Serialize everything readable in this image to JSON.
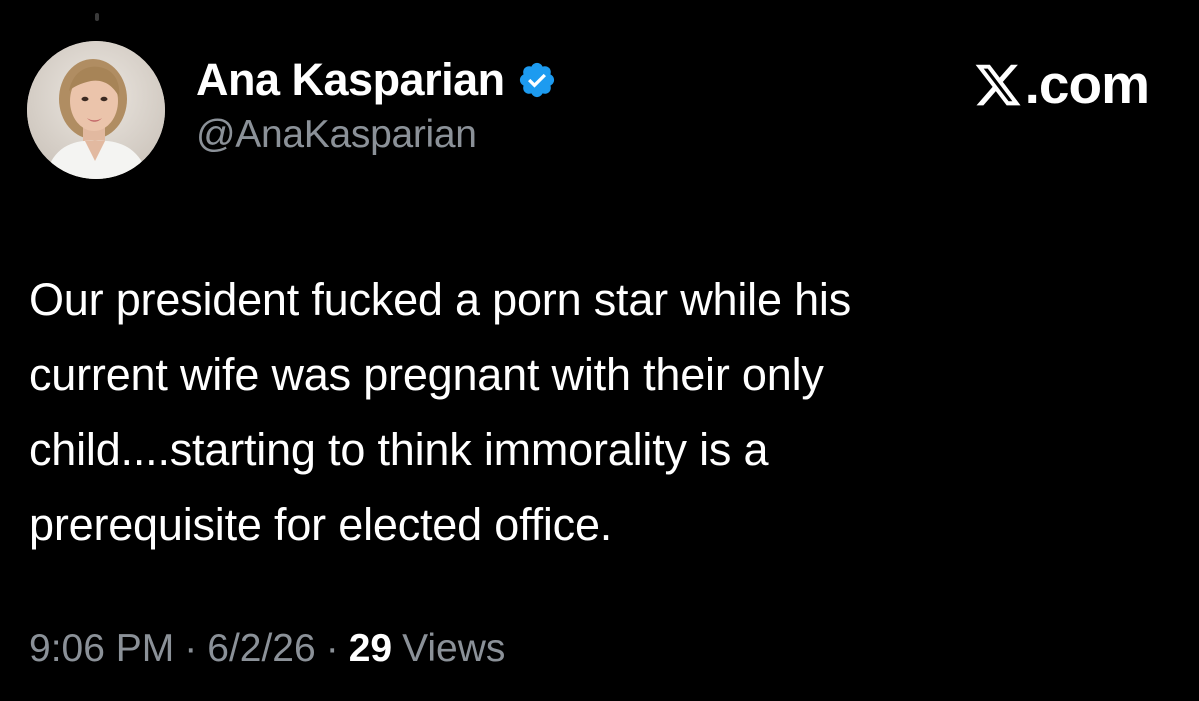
{
  "author": {
    "display_name": "Ana Kasparian",
    "handle": "@AnaKasparian",
    "verified": true,
    "badge_color": "#1d9bf0"
  },
  "brand": {
    "label": ".com",
    "logo_icon": "x-logo-icon"
  },
  "tweet": {
    "lines": [
      "Our president fucked a porn star while his",
      "current wife was pregnant with their only",
      "child....starting to think immorality is a",
      "prerequisite for elected office."
    ]
  },
  "meta": {
    "time": "9:06 PM",
    "separator": "·",
    "date": "6/2/26",
    "views_count": "29",
    "views_label": "Views"
  },
  "colors": {
    "background": "#000000",
    "text_primary": "#ffffff",
    "text_secondary": "#8b9198",
    "accent": "#1d9bf0"
  }
}
